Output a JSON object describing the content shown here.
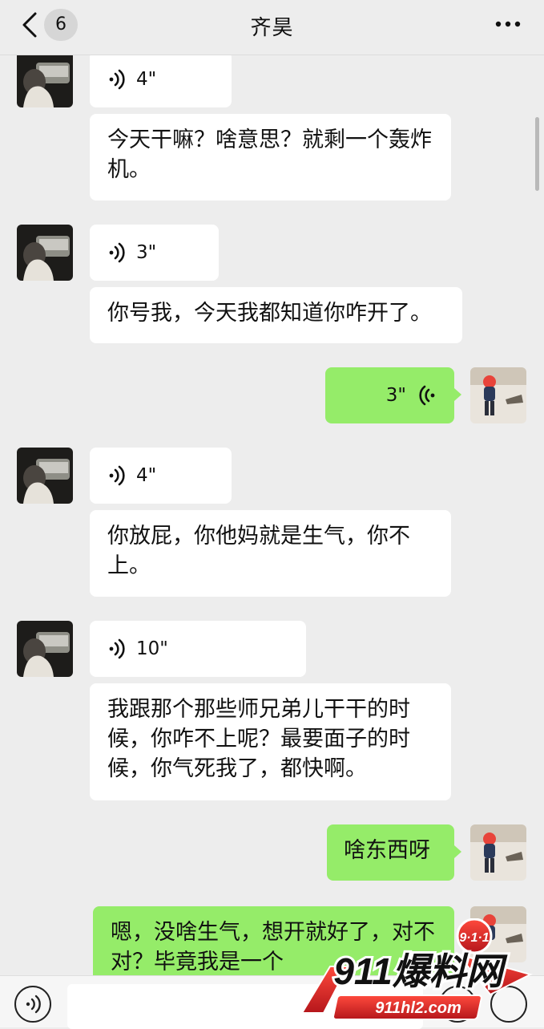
{
  "header": {
    "title": "齐昊",
    "unread_count": "6",
    "back_icon": "chevron-left-icon",
    "more_icon": "more-dots-icon"
  },
  "messages": [
    {
      "side": "left",
      "type": "voice",
      "duration": "4\""
    },
    {
      "side": "left",
      "type": "text",
      "text": "今天干嘛？啥意思？就剩一个轰炸机。"
    },
    {
      "side": "left",
      "type": "voice",
      "duration": "3\""
    },
    {
      "side": "left",
      "type": "text",
      "text": "你号我，今天我都知道你咋开了。"
    },
    {
      "side": "right",
      "type": "voice",
      "duration": "3\""
    },
    {
      "side": "left",
      "type": "voice",
      "duration": "4\""
    },
    {
      "side": "left",
      "type": "text",
      "text": "你放屁，你他妈就是生气，你不上。"
    },
    {
      "side": "left",
      "type": "voice",
      "duration": "10\""
    },
    {
      "side": "left",
      "type": "text",
      "text": "我跟那个那些师兄弟儿干干的时候，你咋不上呢？最要面子的时候，你气死我了，都快啊。"
    },
    {
      "side": "right",
      "type": "text",
      "text": "啥东西呀"
    },
    {
      "side": "right",
      "type": "text",
      "text": "嗯，没啥生气，想开就好了，对不对？毕竟我是一个"
    }
  ],
  "input_bar": {
    "voice_icon": "voice-mode-icon",
    "emoji_icon": "emoji-icon",
    "plus_icon": "plus-icon",
    "placeholder": ""
  },
  "watermark": {
    "badge": "9·1·1",
    "brand": "911爆料网",
    "url": "911hl2.com"
  },
  "colors": {
    "background": "#ededed",
    "bubble_received": "#ffffff",
    "bubble_sent": "#95ec69",
    "watermark_red": "#e0262a"
  }
}
